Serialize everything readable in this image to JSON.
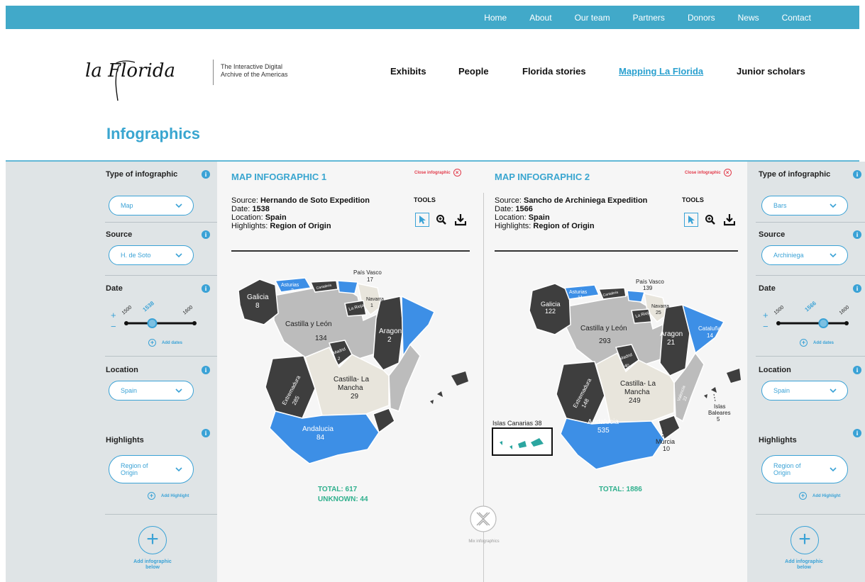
{
  "topnav": [
    "Home",
    "About",
    "Our team",
    "Partners",
    "Donors",
    "News",
    "Contact"
  ],
  "header": {
    "logo_text": "la Florida",
    "tagline_1": "The Interactive Digital",
    "tagline_2": "Archive of the Americas",
    "nav": [
      "Exhibits",
      "People",
      "Florida stories",
      "Mapping La Florida",
      "Junior scholars"
    ],
    "active_nav": "Mapping La Florida"
  },
  "page_title": "Infographics",
  "left_panel": {
    "type_label": "Type of infographic",
    "type_value": "Map",
    "source_label": "Source",
    "source_value": "H. de Soto",
    "date_label": "Date",
    "date_min": "1500",
    "date_value": "1538",
    "date_max": "1600",
    "date_fraction": 0.38,
    "add_dates": "Add dates",
    "location_label": "Location",
    "location_value": "Spain",
    "highlights_label": "Highlights",
    "highlights_value_1": "Region of",
    "highlights_value_2": "Origin",
    "add_highlight": "Add Highlight",
    "add_below_1": "Add infographic",
    "add_below_2": "below"
  },
  "right_panel": {
    "type_label": "Type of infographic",
    "type_value": "Bars",
    "source_label": "Source",
    "source_value": "Archiniega",
    "date_label": "Date",
    "date_min": "1500",
    "date_value": "1566",
    "date_max": "1600",
    "date_fraction": 0.66,
    "add_dates": "Add dates",
    "location_label": "Location",
    "location_value": "Spain",
    "highlights_label": "Highlights",
    "highlights_value_1": "Region of",
    "highlights_value_2": "Origin",
    "add_highlight": "Add Highlight",
    "add_below_1": "Add infographic",
    "add_below_2": "below"
  },
  "infographic1": {
    "title": "MAP INFOGRAPHIC 1",
    "close": "Close infographic",
    "source_label": "Source:",
    "source": "Hernando de Soto Expedition",
    "date_label": "Date:",
    "date": "1538",
    "location_label": "Location:",
    "location": "Spain",
    "highlights_label": "Highlights:",
    "highlights": "Region of Origin",
    "tools": "TOOLS",
    "total": "TOTAL: 617",
    "unknown": "UNKNOWN: 44",
    "regions": {
      "galicia": "Galicia",
      "galicia_n": "8",
      "asturias": "Asturias",
      "asturias_n": "2",
      "cantabria": "Cantabria",
      "pais": "País Vasco",
      "pais_n": "17",
      "navarra": "Navarra",
      "navarra_n": "1",
      "rioja": "La Rioja",
      "cyl": "Castilla y León",
      "cyl_n": "134",
      "aragon": "Aragon",
      "aragon_n": "2",
      "madrid": "Madrid",
      "madrid_n": "2",
      "extremadura": "Extremadura",
      "extremadura_n": "285",
      "clm_1": "Castilla- La",
      "clm_2": "Mancha",
      "clm_n": "29",
      "andalucia": "Andalucia",
      "andalucia_n": "84"
    }
  },
  "infographic2": {
    "title": "MAP INFOGRAPHIC 2",
    "close": "Close infographic",
    "source_label": "Source:",
    "source": "Sancho de Archiniega Expedition",
    "date_label": "Date:",
    "date": "1566",
    "location_label": "Location:",
    "location": "Spain",
    "highlights_label": "Highlights:",
    "highlights": "Region of Origin",
    "tools": "TOOLS",
    "total": "TOTAL: 1886",
    "regions": {
      "galicia": "Galicia",
      "galicia_n": "122",
      "asturias": "Asturias",
      "asturias_n": "11",
      "cantabria": "Cantabria",
      "pais": "País Vasco",
      "pais_n": "139",
      "navarra": "Navarra",
      "navarra_n": "25",
      "rioja": "La Rioja",
      "cyl": "Castilla y León",
      "cyl_n": "293",
      "aragon": "Aragon",
      "aragon_n": "21",
      "cataluna": "Cataluña",
      "cataluna_n": "14",
      "madrid": "Madrid",
      "madrid_n": "40",
      "extremadura": "Extremadura",
      "extremadura_n": "148",
      "clm_1": "Castilla- La",
      "clm_2": "Mancha",
      "clm_n": "249",
      "valencia": "Valencia",
      "valencia_n": "22",
      "islas_1": "Islas",
      "islas_2": "Baleares",
      "islas_n": "5",
      "andalucia": "Andalucia",
      "andalucia_n": "535",
      "murcia": "Murcia",
      "murcia_n": "10",
      "canarias": "Islas Canarias 38"
    }
  },
  "mix_label": "Mix infographics",
  "colors": {
    "accent": "#3aa6d0",
    "topbar": "#41a9c9",
    "dark_region": "#3e3e3e",
    "grey_region": "#bcbcbc",
    "light_region": "#e8e5dc",
    "blue_region": "#3d8fe6",
    "total": "#2fb08d",
    "close": "#e23a4a"
  }
}
